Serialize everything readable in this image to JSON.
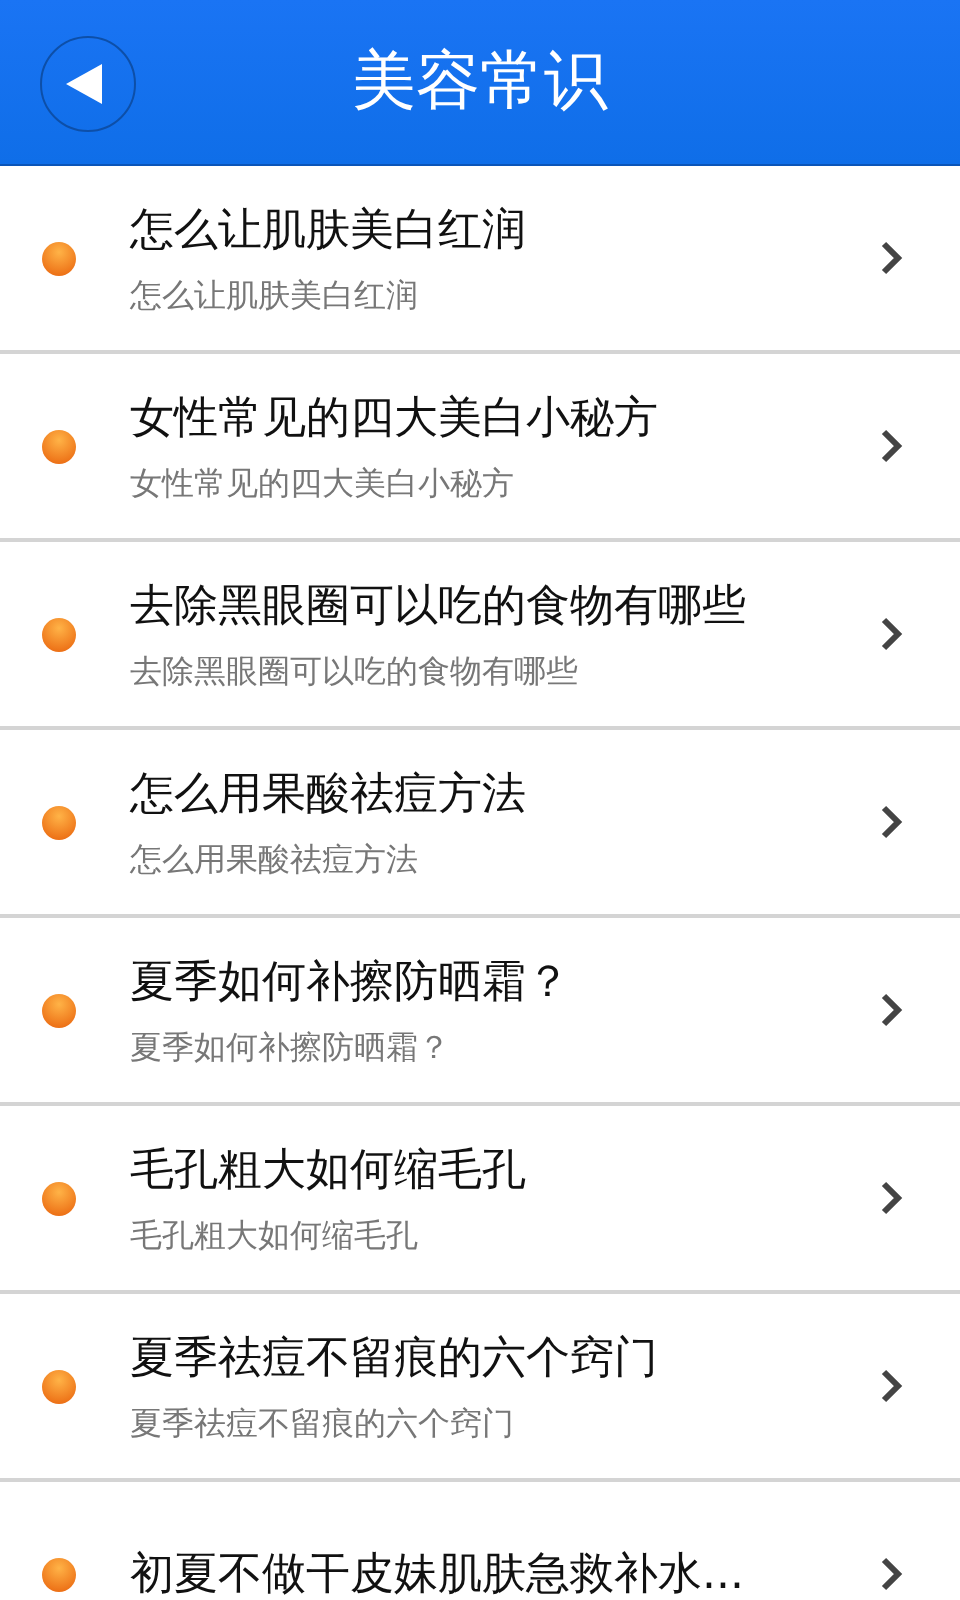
{
  "header": {
    "title": "美容常识"
  },
  "items": [
    {
      "title": "怎么让肌肤美白红润",
      "subtitle": "怎么让肌肤美白红润"
    },
    {
      "title": "女性常见的四大美白小秘方",
      "subtitle": "女性常见的四大美白小秘方"
    },
    {
      "title": "去除黑眼圈可以吃的食物有哪些",
      "subtitle": "去除黑眼圈可以吃的食物有哪些"
    },
    {
      "title": "怎么用果酸祛痘方法",
      "subtitle": "怎么用果酸祛痘方法"
    },
    {
      "title": "夏季如何补擦防晒霜？",
      "subtitle": "夏季如何补擦防晒霜？"
    },
    {
      "title": "毛孔粗大如何缩毛孔",
      "subtitle": "毛孔粗大如何缩毛孔"
    },
    {
      "title": "夏季祛痘不留痕的六个窍门",
      "subtitle": "夏季祛痘不留痕的六个窍门"
    },
    {
      "title": "初夏不做干皮妹肌肤急救补水..."
    }
  ]
}
